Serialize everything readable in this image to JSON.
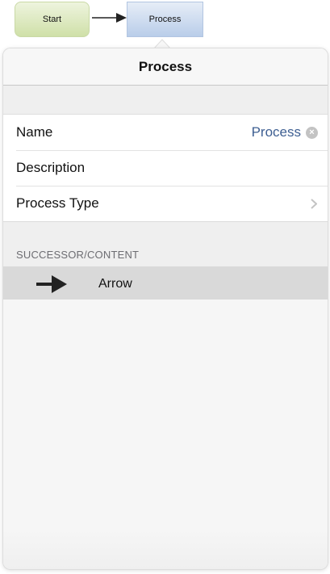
{
  "diagram": {
    "start_node": "Start",
    "process_node": "Process"
  },
  "popover": {
    "title": "Process",
    "fields": {
      "name_label": "Name",
      "name_value": "Process",
      "description_label": "Description",
      "process_type_label": "Process Type"
    },
    "section_header": "SUCCESSOR/CONTENT",
    "successor": {
      "label": "Arrow",
      "icon": "right-arrow-icon"
    }
  },
  "icons": {
    "clear": "clear-icon",
    "chevron": "chevron-right-icon"
  },
  "colors": {
    "value_text": "#3e5f92",
    "selected_row": "#d9d9d9"
  }
}
